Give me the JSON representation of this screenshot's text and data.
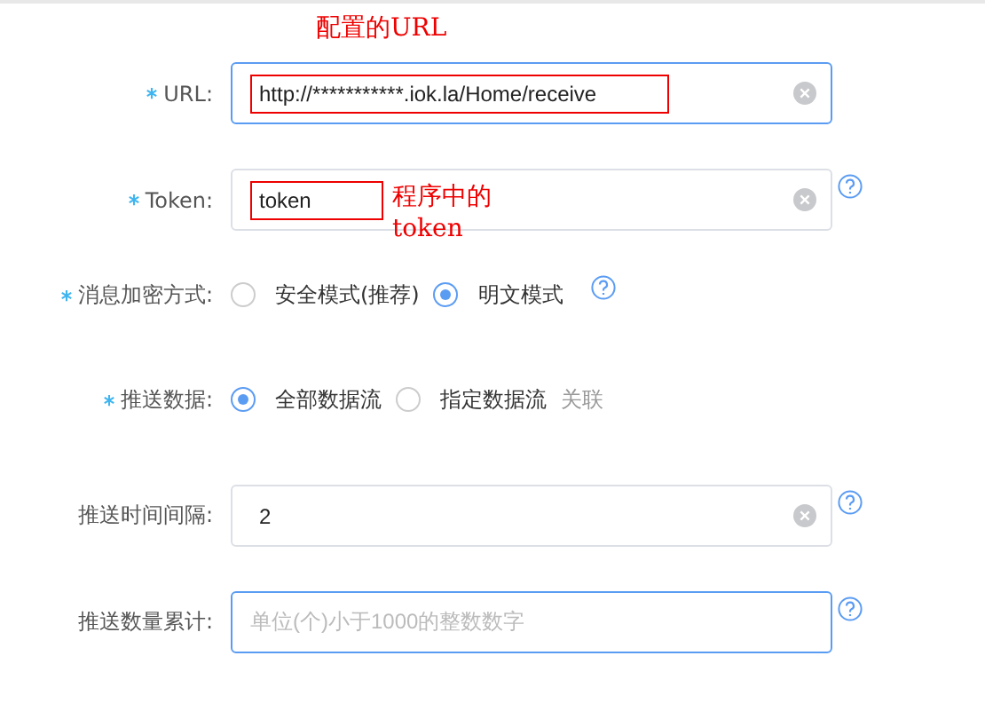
{
  "form": [
    {
      "kind": "text",
      "label": "URL:",
      "required": true,
      "value": "http://***********.iok.la/Home/receive",
      "focused": true,
      "clearable": true,
      "help": false,
      "highlighted": true,
      "note_above": "配置的URL"
    },
    {
      "kind": "text",
      "label": "Token:",
      "required": true,
      "value": "token",
      "focused": false,
      "clearable": true,
      "help": true,
      "highlighted": true,
      "note_beside": "程序中的token"
    },
    {
      "kind": "radio",
      "label": "消息加密方式:",
      "required": true,
      "help": true,
      "options": [
        {
          "label": "安全模式(推荐)",
          "selected": false
        },
        {
          "label": "明文模式",
          "selected": true
        }
      ]
    },
    {
      "kind": "radio",
      "label": "推送数据:",
      "required": true,
      "help": false,
      "options": [
        {
          "label": "全部数据流",
          "selected": true
        },
        {
          "label": "指定数据流",
          "selected": false
        }
      ],
      "link": "关联"
    },
    {
      "kind": "text",
      "label": "推送时间间隔:",
      "required": false,
      "value": "2",
      "focused": false,
      "clearable": true,
      "help": true,
      "highlighted": false
    },
    {
      "kind": "text",
      "label": "推送数量累计:",
      "required": false,
      "placeholder": "单位(个)小于1000的整数数字",
      "focused": true,
      "clearable": false,
      "help": true,
      "highlighted": false
    }
  ]
}
